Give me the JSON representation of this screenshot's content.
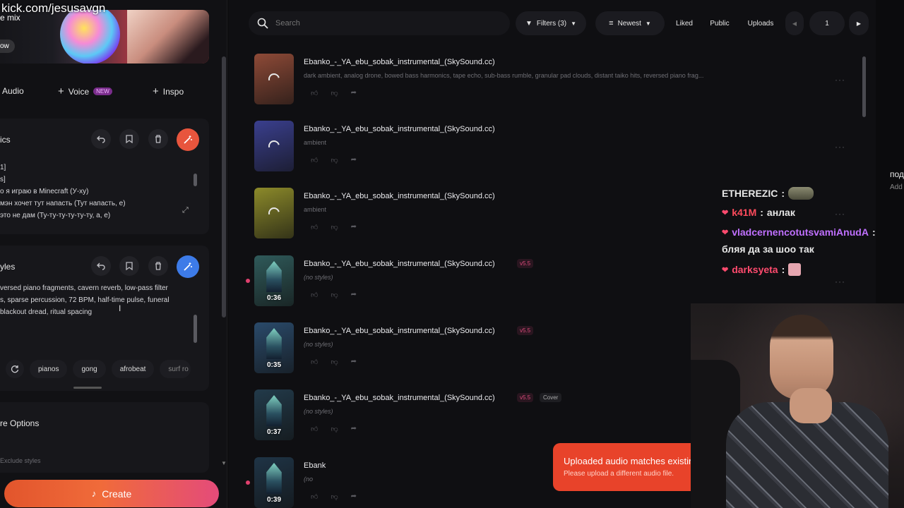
{
  "stream": {
    "url": "kick.com/jesusavgn"
  },
  "left": {
    "banner": {
      "title": "e mix",
      "button": "ow"
    },
    "tabs": [
      {
        "label": "Audio"
      },
      {
        "label": "Voice",
        "badge": "NEW"
      },
      {
        "label": "Inspo"
      }
    ],
    "lyrics": {
      "title": "ics",
      "lines": [
        "1]",
        "s]",
        "о я играю в Minecraft (У-ху)",
        "мэн хочет тут напасть (Тут напасть, е)",
        "это не дам (Ту-ту-ту-ту-ту-ту, а, е)"
      ]
    },
    "styles": {
      "title": "yles",
      "lines": [
        "versed piano fragments, cavern reverb, low-pass filter",
        "s, sparse percussion, 72 BPM, half-time pulse, funeral",
        "blackout dread, ritual spacing"
      ]
    },
    "chips": [
      "pianos",
      "gong",
      "afrobeat",
      "surf ro"
    ],
    "more_options": "re Options",
    "exclude_placeholder": "Exclude styles",
    "create_label": "Create"
  },
  "toolbar": {
    "search_placeholder": "Search",
    "filters": "Filters (3)",
    "sort": "Newest",
    "liked": "Liked",
    "public": "Public",
    "uploads": "Uploads",
    "page": "1"
  },
  "songs": [
    {
      "title": "Ebanko_-_YA_ebu_sobak_instrumental_(SkySound.cc)",
      "desc": "dark ambient, analog drone, bowed bass harmonics, tape echo, sub-bass rumble, granular pad clouds, distant taiko hits, reversed piano frag...",
      "duration": "",
      "version": "",
      "tag": "",
      "color": "#8e4a37",
      "loading": true,
      "new": false
    },
    {
      "title": "Ebanko_-_YA_ebu_sobak_instrumental_(SkySound.cc)",
      "desc": "ambient",
      "duration": "",
      "version": "",
      "tag": "",
      "color": "#3a3f8e",
      "loading": true,
      "new": false
    },
    {
      "title": "Ebanko_-_YA_ebu_sobak_instrumental_(SkySound.cc)",
      "desc": "ambient",
      "duration": "",
      "version": "",
      "tag": "",
      "color": "#8c8a2a",
      "loading": true,
      "new": false
    },
    {
      "title": "Ebanko_-_YA_ebu_sobak_instrumental_(SkySound.cc)",
      "desc": "(no styles)",
      "duration": "0:36",
      "version": "v5.5",
      "tag": "",
      "color": "#2f5a5a",
      "loading": false,
      "new": true
    },
    {
      "title": "Ebanko_-_YA_ebu_sobak_instrumental_(SkySound.cc)",
      "desc": "(no styles)",
      "duration": "0:35",
      "version": "v5.5",
      "tag": "",
      "color": "#2a4a6a",
      "loading": false,
      "new": false
    },
    {
      "title": "Ebanko_-_YA_ebu_sobak_instrumental_(SkySound.cc)",
      "desc": "(no styles)",
      "duration": "0:37",
      "version": "v5.5",
      "tag": "Cover",
      "color": "#223a4a",
      "loading": false,
      "new": false
    },
    {
      "title": "Ebank",
      "desc": "(no",
      "duration": "0:39",
      "version": "",
      "tag": "",
      "color": "#1f3446",
      "loading": false,
      "new": true
    }
  ],
  "toast": {
    "message": "Uploaded audio matches existing work of art.",
    "sub": "Please upload a different audio file."
  },
  "chat": [
    {
      "user": "ETHEREZIC",
      "color": "#e6e6e6",
      "text": "",
      "emote": "emote",
      "heart": false
    },
    {
      "user": "k41M",
      "color": "#ff4b5c",
      "text": "анлак",
      "emote": "",
      "heart": true
    },
    {
      "user": "vladcernencotutsvamiAnudA",
      "color": "#c070ff",
      "text": "",
      "emote": "",
      "heart": true
    },
    {
      "user": "",
      "color": "#e6e6e6",
      "text": "бляя да за шоо так",
      "emote": "",
      "heart": false
    },
    {
      "user": "darksyeta",
      "color": "#ff4b6e",
      "text": "",
      "emote": "emote2",
      "heart": true
    }
  ],
  "right_edge": {
    "t1": "под",
    "t2": "Add"
  },
  "colors": {
    "accent_orange": "#e8553d",
    "accent_blue": "#3d7be8",
    "toast_red": "#e8432a",
    "version_pink": "#d94a7a"
  }
}
